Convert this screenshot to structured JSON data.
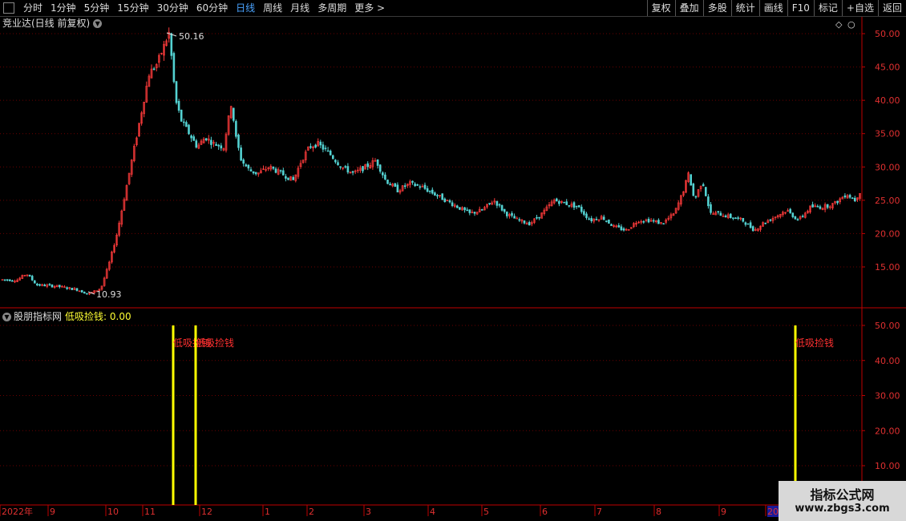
{
  "toolbar": {
    "periods": [
      "分时",
      "1分钟",
      "5分钟",
      "15分钟",
      "30分钟",
      "60分钟",
      "日线",
      "周线",
      "月线",
      "多周期",
      "更多 >"
    ],
    "active_period": "日线",
    "right_buttons": [
      "复权",
      "叠加",
      "多股",
      "统计",
      "画线",
      "F10",
      "标记",
      "+自选",
      "返回"
    ]
  },
  "main_chart": {
    "title": "竞业达(日线 前复权)",
    "y_ticks": [
      "50.00",
      "45.00",
      "40.00",
      "35.00",
      "30.00",
      "25.00",
      "20.00",
      "15.00"
    ],
    "high_label": "50.16",
    "low_label": "10.93"
  },
  "indicator": {
    "source": "股朋指标网",
    "name": "低吸捡钱: 0.00",
    "y_ticks": [
      "50.00",
      "40.00",
      "30.00",
      "20.00",
      "10.00"
    ],
    "signal_label": "低吸捡钱"
  },
  "date_axis": {
    "labels": [
      "2022年",
      "9",
      "10",
      "11",
      "12",
      "1",
      "2",
      "3",
      "4",
      "5",
      "6",
      "7",
      "8",
      "9",
      "20"
    ]
  },
  "watermark": {
    "line1": "指标公式网",
    "line2": "www.zbgs3.com"
  },
  "colors": {
    "up": "#ff3b3b",
    "down": "#54d2d2",
    "grid": "#7a0000",
    "signal": "#ffff00"
  },
  "chart_data": {
    "type": "candlestick",
    "y_range": [
      10,
      51
    ],
    "indicator_range": [
      0,
      55
    ],
    "close_path": [
      [
        0,
        13.1
      ],
      [
        20,
        13.0
      ],
      [
        32,
        14.0
      ],
      [
        45,
        12.3
      ],
      [
        70,
        12.1
      ],
      [
        95,
        11.6
      ],
      [
        110,
        10.93
      ],
      [
        125,
        11.8
      ],
      [
        135,
        15.5
      ],
      [
        145,
        20
      ],
      [
        155,
        26
      ],
      [
        165,
        32
      ],
      [
        175,
        38
      ],
      [
        185,
        44
      ],
      [
        195,
        45.5
      ],
      [
        210,
        50.16
      ],
      [
        218,
        40
      ],
      [
        225,
        37
      ],
      [
        235,
        35
      ],
      [
        245,
        33
      ],
      [
        255,
        34.5
      ],
      [
        265,
        33.5
      ],
      [
        278,
        33
      ],
      [
        288,
        40
      ],
      [
        292,
        35
      ],
      [
        300,
        31
      ],
      [
        310,
        29.5
      ],
      [
        320,
        29
      ],
      [
        335,
        30
      ],
      [
        350,
        29
      ],
      [
        365,
        28
      ],
      [
        375,
        31
      ],
      [
        385,
        33
      ],
      [
        395,
        33.5
      ],
      [
        410,
        32
      ],
      [
        425,
        30
      ],
      [
        440,
        29
      ],
      [
        455,
        30
      ],
      [
        468,
        31
      ],
      [
        480,
        28
      ],
      [
        495,
        26.5
      ],
      [
        510,
        27.5
      ],
      [
        525,
        27
      ],
      [
        540,
        26
      ],
      [
        555,
        25
      ],
      [
        570,
        24
      ],
      [
        585,
        23
      ],
      [
        600,
        23.5
      ],
      [
        615,
        25
      ],
      [
        630,
        23
      ],
      [
        645,
        22
      ],
      [
        660,
        21.5
      ],
      [
        675,
        23
      ],
      [
        690,
        25
      ],
      [
        705,
        24.5
      ],
      [
        720,
        24
      ],
      [
        735,
        22
      ],
      [
        750,
        22.5
      ],
      [
        765,
        21
      ],
      [
        780,
        20.5
      ],
      [
        795,
        22
      ],
      [
        810,
        22
      ],
      [
        825,
        21.5
      ],
      [
        840,
        23
      ],
      [
        850,
        26
      ],
      [
        858,
        29
      ],
      [
        865,
        25
      ],
      [
        875,
        28
      ],
      [
        885,
        23
      ],
      [
        895,
        23
      ],
      [
        910,
        22.5
      ],
      [
        925,
        22
      ],
      [
        940,
        20.5
      ],
      [
        950,
        21.5
      ],
      [
        965,
        22.5
      ],
      [
        980,
        23.5
      ],
      [
        995,
        22
      ],
      [
        1010,
        24
      ],
      [
        1025,
        24
      ],
      [
        1040,
        24.5
      ],
      [
        1055,
        26
      ],
      [
        1065,
        25
      ],
      [
        1075,
        27
      ]
    ],
    "signals": [
      {
        "date": "2022-11",
        "value": 50
      },
      {
        "date": "2022-12",
        "value": 50
      },
      {
        "date": "2023-10",
        "value": 50
      }
    ]
  }
}
